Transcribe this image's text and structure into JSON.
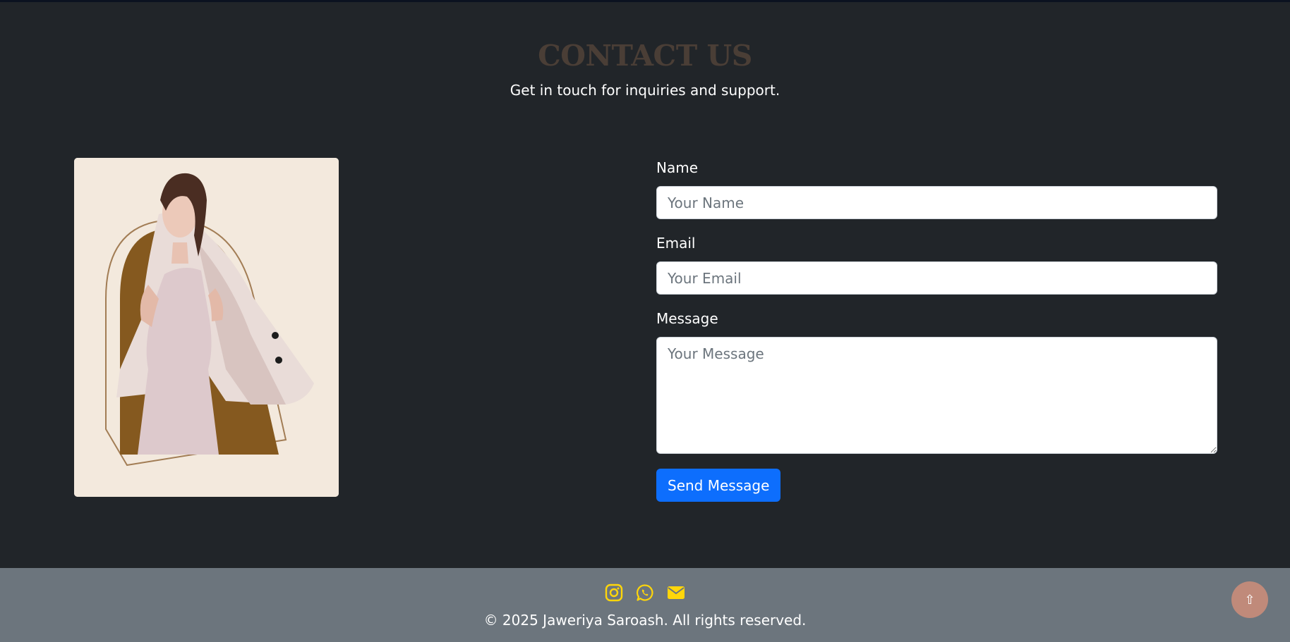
{
  "colors": {
    "page_bg": "#212529",
    "title": "#4a3e36",
    "footer_bg": "#6c757d",
    "icon_accent": "#ffd60a",
    "primary_button": "#0d6efd",
    "back_to_top": "#c08a7a"
  },
  "contact": {
    "title": "CONTACT US",
    "subtitle": "Get in touch for inquiries and support."
  },
  "form": {
    "name_label": "Name",
    "name_placeholder": "Your Name",
    "email_label": "Email",
    "email_placeholder": "Your Email",
    "message_label": "Message",
    "message_placeholder": "Your Message",
    "submit_label": "Send Message"
  },
  "footer": {
    "icons": [
      "instagram-icon",
      "whatsapp-icon",
      "envelope-icon"
    ],
    "copyright": "© 2025 Jaweriya Saroash. All rights reserved."
  },
  "back_to_top": {
    "icon": "arrow-up-icon",
    "glyph": "⇧"
  }
}
